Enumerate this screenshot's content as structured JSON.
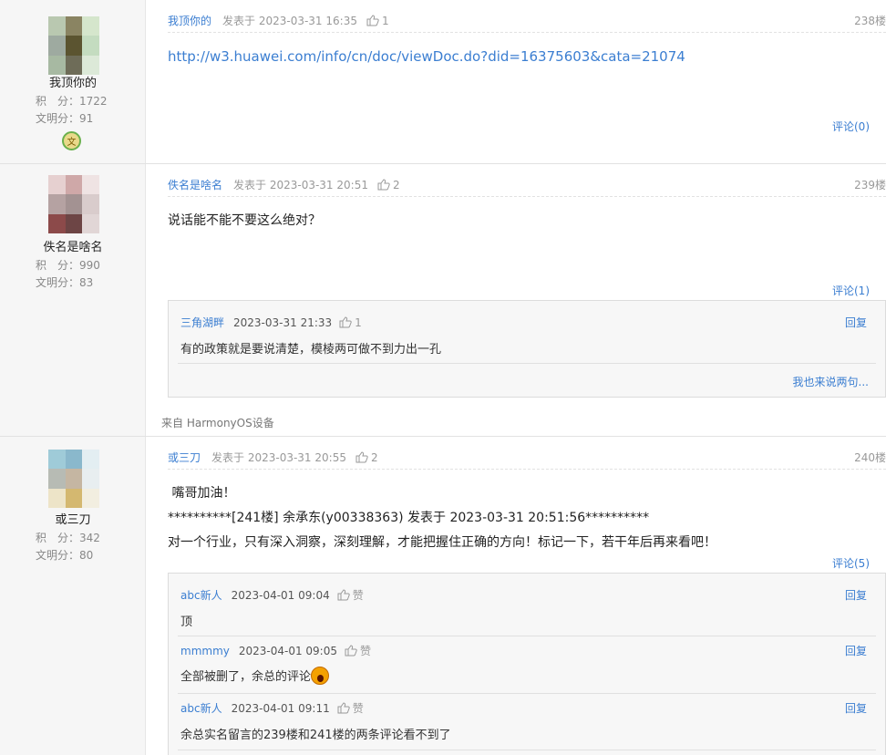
{
  "icons": {
    "thumb": "thumbs-up-icon",
    "medal": "civility-medal-icon",
    "emoji": "shocked-face-emoji"
  },
  "posts": [
    {
      "user": {
        "name": "我顶你的",
        "points_label": "积　分：",
        "points": "1722",
        "civility_label": "文明分：",
        "civility": "91",
        "medal": "文"
      },
      "author": "我顶你的",
      "posted": "发表于 2023-03-31 16:35",
      "likes": "1",
      "floor": "238楼",
      "link": "http://w3.huawei.com/info/cn/doc/viewDoc.do?did=16375603&cata=21074",
      "comments_label": "评论(0)"
    },
    {
      "user": {
        "name": "佚名是啥名",
        "points_label": "积　分：",
        "points": "990",
        "civility_label": "文明分：",
        "civility": "83"
      },
      "author": "佚名是啥名",
      "posted": "发表于 2023-03-31 20:51",
      "likes": "2",
      "floor": "239楼",
      "text": "说话能不能不要这么绝对？",
      "comments_label": "评论(1)",
      "comments": [
        {
          "name": "三角湖畔",
          "time": "2023-03-31 21:33",
          "likes": "1",
          "reply": "回复",
          "text": "有的政策就是要说清楚，模棱两可做不到力出一孔"
        }
      ],
      "more": "我也来说两句...",
      "device": "来自 HarmonyOS设备"
    },
    {
      "user": {
        "name": "或三刀",
        "points_label": "积　分：",
        "points": "342",
        "civility_label": "文明分：",
        "civility": "80"
      },
      "author": "或三刀",
      "posted": "发表于 2023-03-31 20:55",
      "likes": "2",
      "floor": "240楼",
      "lines": [
        " 嘴哥加油！",
        "**********[241楼] 余承东(y00338363) 发表于 2023-03-31 20:51:56**********",
        "对一个行业，只有深入洞察，深刻理解，才能把握住正确的方向！标记一下，若干年后再来看吧！"
      ],
      "comments_label": "评论(5)",
      "comments": [
        {
          "name": "abc新人",
          "time": "2023-04-01 09:04",
          "likes": "赞",
          "reply": "回复",
          "text": "顶"
        },
        {
          "name": "mmmmy",
          "time": "2023-04-01 09:05",
          "likes": "赞",
          "reply": "回复",
          "text": "全部被删了，余总的评论"
        },
        {
          "name": "abc新人",
          "time": "2023-04-01 09:11",
          "likes": "赞",
          "reply": "回复",
          "text": "余总实名留言的239楼和241楼的两条评论看不到了"
        }
      ]
    }
  ]
}
